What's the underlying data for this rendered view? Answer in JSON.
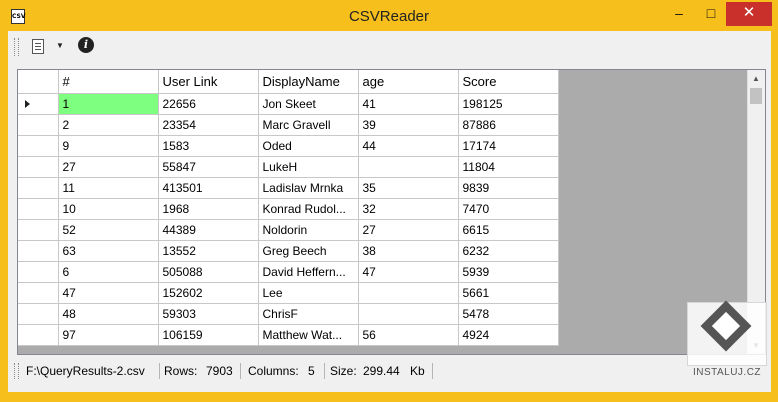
{
  "window": {
    "title": "CSVReader",
    "app_icon": "csv-file-icon",
    "app_icon_text": "CSV",
    "controls": {
      "minimize": "–",
      "maximize": "□",
      "close": "✕"
    },
    "accent": "#f6bf1b"
  },
  "toolbar": {
    "items": [
      {
        "name": "document-menu-icon",
        "type": "dropdown"
      },
      {
        "name": "info-icon",
        "glyph": "i"
      }
    ]
  },
  "grid": {
    "columns": [
      "#",
      "User Link",
      "DisplayName",
      "age",
      "Score"
    ],
    "rows": [
      [
        "1",
        "22656",
        "Jon Skeet",
        "41",
        "198125"
      ],
      [
        "2",
        "23354",
        "Marc Gravell",
        "39",
        "87886"
      ],
      [
        "9",
        "1583",
        "Oded",
        "44",
        "17174"
      ],
      [
        "27",
        "55847",
        "LukeH",
        "",
        "11804"
      ],
      [
        "11",
        "413501",
        "Ladislav Mrnka",
        "35",
        "9839"
      ],
      [
        "10",
        "1968",
        "Konrad Rudol...",
        "32",
        "7470"
      ],
      [
        "52",
        "44389",
        "Noldorin",
        "27",
        "6615"
      ],
      [
        "63",
        "13552",
        "Greg Beech",
        "38",
        "6232"
      ],
      [
        "6",
        "505088",
        "David Heffern...",
        "47",
        "5939"
      ],
      [
        "47",
        "152602",
        "Lee",
        "",
        "5661"
      ],
      [
        "48",
        "59303",
        "ChrisF",
        "",
        "5478"
      ],
      [
        "97",
        "106159",
        "Matthew Wat...",
        "56",
        "4924"
      ]
    ],
    "selected_cell_color": "#7fff7f"
  },
  "statusbar": {
    "file_path": "F:\\QueryResults-2.csv",
    "rows_label": "Rows:",
    "rows_value": "7903",
    "columns_label": "Columns:",
    "columns_value": "5",
    "size_label": "Size:",
    "size_value": "299.44",
    "size_unit": "Kb"
  },
  "watermark": {
    "text": "INSTALUJ.CZ"
  }
}
